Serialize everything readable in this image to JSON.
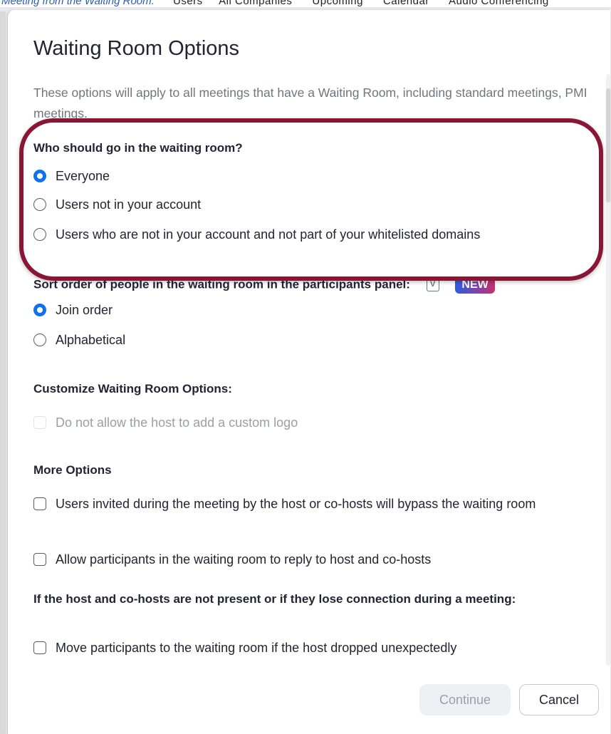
{
  "background": {
    "link_text": "Meeting from the Waiting Room.",
    "column_headers": [
      "Users",
      "All Companies",
      "Upcoming",
      "Calendar",
      "Audio Conferencing"
    ]
  },
  "dialog": {
    "title": "Waiting Room Options",
    "description": "These options will apply to all meetings that have a Waiting Room, including standard meetings, PMI meetings.",
    "who_section": {
      "label": "Who should go in the waiting room?",
      "options": [
        {
          "label": "Everyone",
          "selected": true
        },
        {
          "label": "Users not in your account",
          "selected": false
        },
        {
          "label": "Users who are not in your account and not part of your whitelisted domains",
          "selected": false
        }
      ]
    },
    "sort_section": {
      "label": "Sort order of people in the waiting room in the participants panel:",
      "info_icon": "info-icon",
      "badge": "NEW",
      "options": [
        {
          "label": "Join order",
          "selected": true
        },
        {
          "label": "Alphabetical",
          "selected": false
        }
      ]
    },
    "customize_section": {
      "label": "Customize Waiting Room Options:",
      "options": [
        {
          "label": "Do not allow the host to add a custom logo",
          "checked": false,
          "disabled": true
        }
      ]
    },
    "more_section": {
      "label": "More Options",
      "options": [
        {
          "label": "Users invited during the meeting by the host or co-hosts will bypass the waiting room",
          "checked": false
        },
        {
          "label": "Allow participants in the waiting room to reply to host and co-hosts",
          "checked": false
        }
      ]
    },
    "host_section": {
      "label": "If the host and co-hosts are not present or if they lose connection during a meeting:",
      "options": [
        {
          "label": "Move participants to the waiting room if the host dropped unexpectedly",
          "checked": false
        }
      ]
    },
    "buttons": {
      "continue": "Continue",
      "cancel": "Cancel"
    }
  },
  "colors": {
    "accent": "#0e72ed",
    "highlight_ring": "#8a1635"
  }
}
